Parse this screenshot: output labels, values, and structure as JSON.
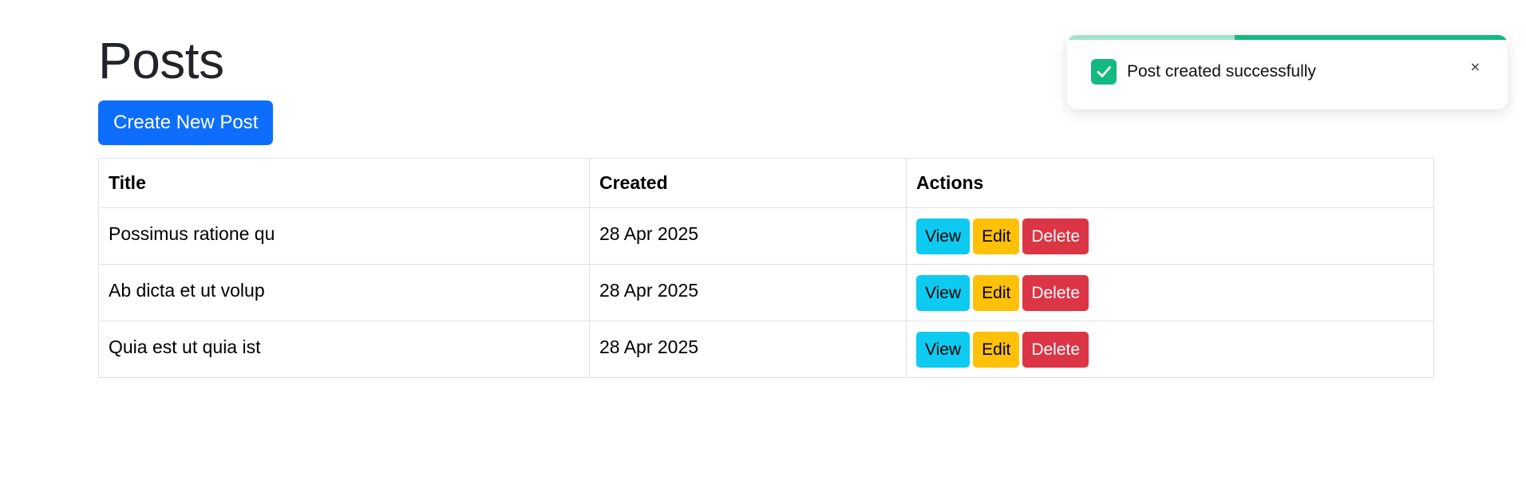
{
  "page": {
    "title": "Posts",
    "create_button_label": "Create New Post"
  },
  "table": {
    "headers": [
      "Title",
      "Created",
      "Actions"
    ],
    "rows": [
      {
        "title": "Possimus ratione qu",
        "created": "28 Apr 2025"
      },
      {
        "title": "Ab dicta et ut volup",
        "created": "28 Apr 2025"
      },
      {
        "title": "Quia est ut quia ist",
        "created": "28 Apr 2025"
      }
    ],
    "actions": {
      "view": "View",
      "edit": "Edit",
      "delete": "Delete"
    }
  },
  "toast": {
    "message": "Post created successfully",
    "close_symbol": "×",
    "icon": "check-icon",
    "progress_remaining": 0.62
  },
  "colors": {
    "primary": "#0d6efd",
    "info": "#0dcaf0",
    "warning": "#ffc107",
    "danger": "#dc3545",
    "success": "#12b981"
  }
}
